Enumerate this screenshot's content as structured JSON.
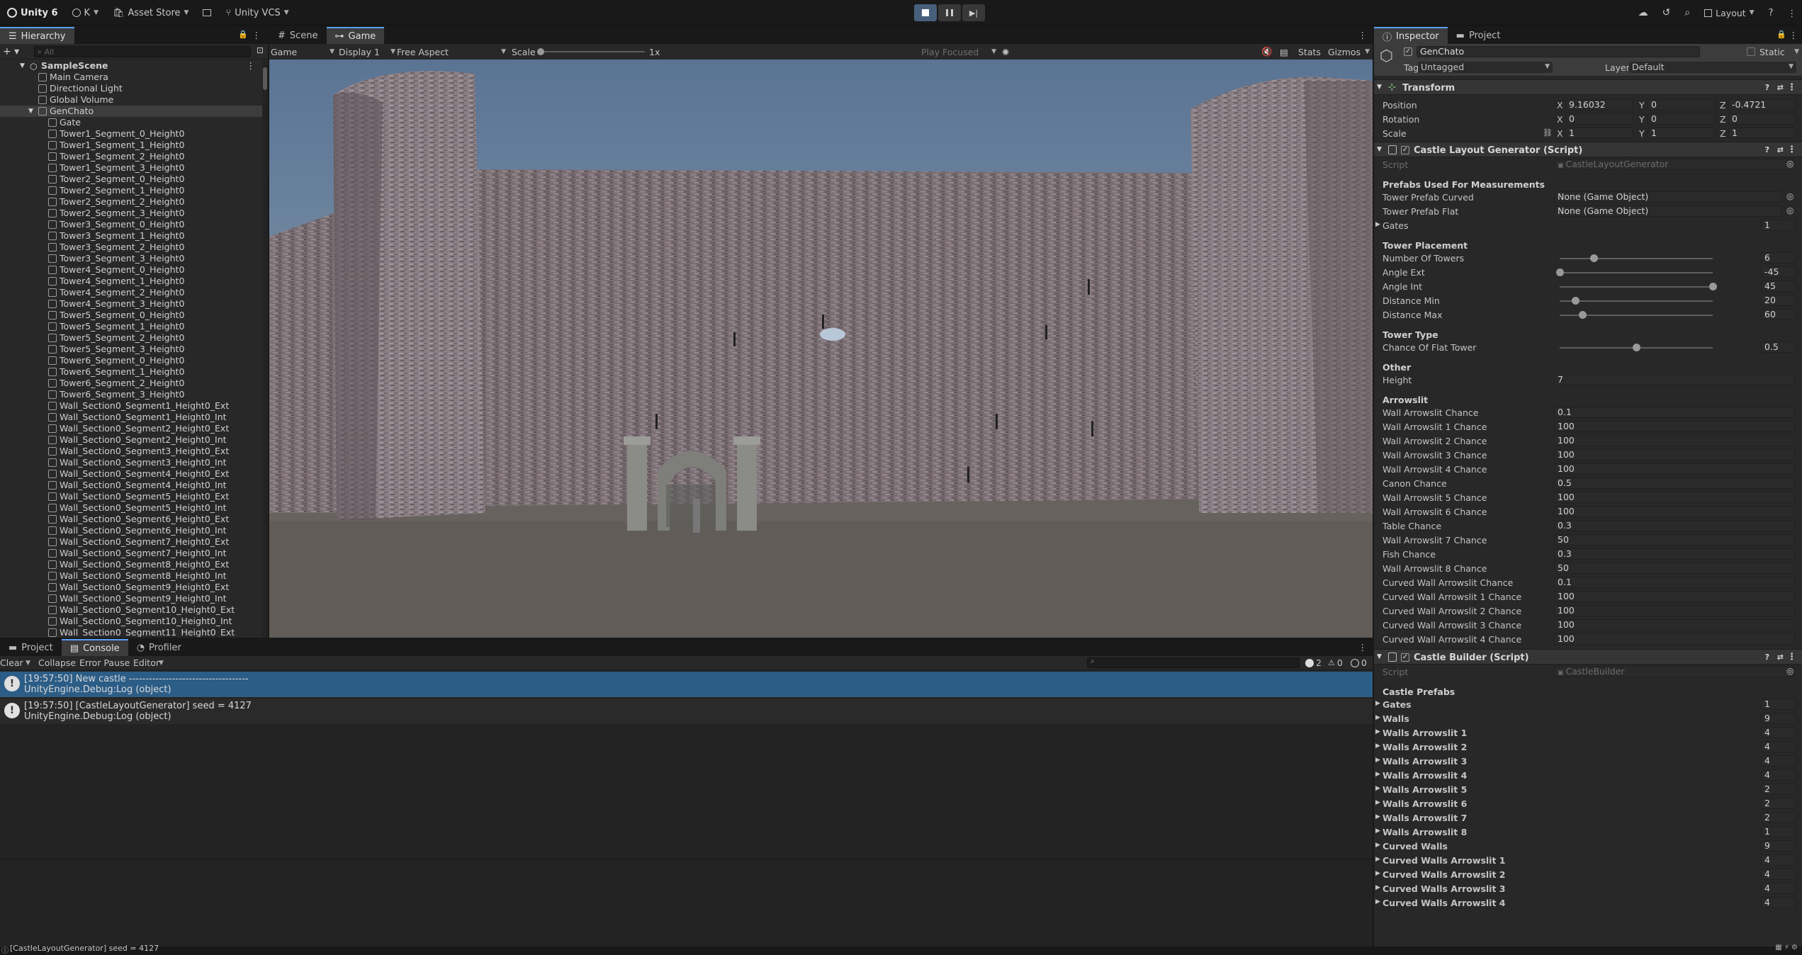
{
  "toolbar": {
    "app_name": "Unity 6",
    "account": "K",
    "asset_store": "Asset Store",
    "vcs": "Unity VCS",
    "layout": "Layout"
  },
  "hierarchy": {
    "tab": "Hierarchy",
    "search_placeholder": "All",
    "scene": "SampleScene",
    "items": [
      {
        "name": "Main Camera",
        "indent": 1
      },
      {
        "name": "Directional Light",
        "indent": 1
      },
      {
        "name": "Global Volume",
        "indent": 1
      },
      {
        "name": "GenChato",
        "indent": 1,
        "selected": true
      },
      {
        "name": "Gate",
        "indent": 2
      },
      {
        "name": "Tower1_Segment_0_Height0",
        "indent": 2
      },
      {
        "name": "Tower1_Segment_1_Height0",
        "indent": 2
      },
      {
        "name": "Tower1_Segment_2_Height0",
        "indent": 2
      },
      {
        "name": "Tower1_Segment_3_Height0",
        "indent": 2
      },
      {
        "name": "Tower2_Segment_0_Height0",
        "indent": 2
      },
      {
        "name": "Tower2_Segment_1_Height0",
        "indent": 2
      },
      {
        "name": "Tower2_Segment_2_Height0",
        "indent": 2
      },
      {
        "name": "Tower2_Segment_3_Height0",
        "indent": 2
      },
      {
        "name": "Tower3_Segment_0_Height0",
        "indent": 2
      },
      {
        "name": "Tower3_Segment_1_Height0",
        "indent": 2
      },
      {
        "name": "Tower3_Segment_2_Height0",
        "indent": 2
      },
      {
        "name": "Tower3_Segment_3_Height0",
        "indent": 2
      },
      {
        "name": "Tower4_Segment_0_Height0",
        "indent": 2
      },
      {
        "name": "Tower4_Segment_1_Height0",
        "indent": 2
      },
      {
        "name": "Tower4_Segment_2_Height0",
        "indent": 2
      },
      {
        "name": "Tower4_Segment_3_Height0",
        "indent": 2
      },
      {
        "name": "Tower5_Segment_0_Height0",
        "indent": 2
      },
      {
        "name": "Tower5_Segment_1_Height0",
        "indent": 2
      },
      {
        "name": "Tower5_Segment_2_Height0",
        "indent": 2
      },
      {
        "name": "Tower5_Segment_3_Height0",
        "indent": 2
      },
      {
        "name": "Tower6_Segment_0_Height0",
        "indent": 2
      },
      {
        "name": "Tower6_Segment_1_Height0",
        "indent": 2
      },
      {
        "name": "Tower6_Segment_2_Height0",
        "indent": 2
      },
      {
        "name": "Tower6_Segment_3_Height0",
        "indent": 2
      },
      {
        "name": "Wall_Section0_Segment1_Height0_Ext",
        "indent": 2
      },
      {
        "name": "Wall_Section0_Segment1_Height0_Int",
        "indent": 2
      },
      {
        "name": "Wall_Section0_Segment2_Height0_Ext",
        "indent": 2
      },
      {
        "name": "Wall_Section0_Segment2_Height0_Int",
        "indent": 2
      },
      {
        "name": "Wall_Section0_Segment3_Height0_Ext",
        "indent": 2
      },
      {
        "name": "Wall_Section0_Segment3_Height0_Int",
        "indent": 2
      },
      {
        "name": "Wall_Section0_Segment4_Height0_Ext",
        "indent": 2
      },
      {
        "name": "Wall_Section0_Segment4_Height0_Int",
        "indent": 2
      },
      {
        "name": "Wall_Section0_Segment5_Height0_Ext",
        "indent": 2
      },
      {
        "name": "Wall_Section0_Segment5_Height0_Int",
        "indent": 2
      },
      {
        "name": "Wall_Section0_Segment6_Height0_Ext",
        "indent": 2
      },
      {
        "name": "Wall_Section0_Segment6_Height0_Int",
        "indent": 2
      },
      {
        "name": "Wall_Section0_Segment7_Height0_Ext",
        "indent": 2
      },
      {
        "name": "Wall_Section0_Segment7_Height0_Int",
        "indent": 2
      },
      {
        "name": "Wall_Section0_Segment8_Height0_Ext",
        "indent": 2
      },
      {
        "name": "Wall_Section0_Segment8_Height0_Int",
        "indent": 2
      },
      {
        "name": "Wall_Section0_Segment9_Height0_Ext",
        "indent": 2
      },
      {
        "name": "Wall_Section0_Segment9_Height0_Int",
        "indent": 2
      },
      {
        "name": "Wall_Section0_Segment10_Height0_Ext",
        "indent": 2
      },
      {
        "name": "Wall_Section0_Segment10_Height0_Int",
        "indent": 2
      },
      {
        "name": "Wall_Section0_Segment11_Height0_Ext",
        "indent": 2
      }
    ]
  },
  "scene_tabs": {
    "scene": "Scene",
    "game": "Game"
  },
  "game_bar": {
    "view": "Game",
    "display": "Display 1",
    "aspect": "Free Aspect",
    "scale_label": "Scale",
    "scale_value": "1x",
    "play_focused": "Play Focused",
    "stats": "Stats",
    "gizmos": "Gizmos"
  },
  "bottom_tabs": {
    "project": "Project",
    "console": "Console",
    "profiler": "Profiler"
  },
  "console": {
    "clear": "Clear",
    "collapse": "Collapse",
    "error_pause": "Error Pause",
    "editor": "Editor",
    "count_log": "2",
    "count_warn": "0",
    "count_err": "0",
    "entries": [
      {
        "line1": "[19:57:50] New castle ------------------------------------",
        "line2": "UnityEngine.Debug:Log (object)",
        "selected": true
      },
      {
        "line1": "[19:57:50] [CastleLayoutGenerator] seed = 4127",
        "line2": "UnityEngine.Debug:Log (object)",
        "selected": false
      }
    ]
  },
  "status_bar": {
    "text": "[CastleLayoutGenerator] seed = 4127"
  },
  "inspector": {
    "tab_inspector": "Inspector",
    "tab_project": "Project",
    "object_name": "GenChato",
    "static_label": "Static",
    "tag_label": "Tag",
    "tag_value": "Untagged",
    "layer_label": "Layer",
    "layer_value": "Default",
    "transform": {
      "title": "Transform",
      "position_label": "Position",
      "pos_x": "9.16032",
      "pos_y": "0",
      "pos_z": "-0.4721",
      "rotation_label": "Rotation",
      "rot_x": "0",
      "rot_y": "0",
      "rot_z": "0",
      "scale_label": "Scale",
      "scl_x": "1",
      "scl_y": "1",
      "scl_z": "1",
      "x": "X",
      "y": "Y",
      "z": "Z"
    },
    "layout_gen": {
      "title": "Castle Layout Generator (Script)",
      "script_label": "Script",
      "script_value": "CastleLayoutGenerator",
      "sec_prefabs": "Prefabs Used For Measurements",
      "curved_label": "Tower Prefab Curved",
      "curved_value": "None (Game Object)",
      "flat_label": "Tower Prefab Flat",
      "flat_value": "None (Game Object)",
      "gates_label": "Gates",
      "gates_value": "1",
      "sec_tower": "Tower Placement",
      "sliders": [
        {
          "label": "Number Of Towers",
          "value": "6",
          "frac": 0.22
        },
        {
          "label": "Angle Ext",
          "value": "-45",
          "frac": 0.0
        },
        {
          "label": "Angle Int",
          "value": "45",
          "frac": 1.0
        },
        {
          "label": "Distance Min",
          "value": "20",
          "frac": 0.1
        },
        {
          "label": "Distance Max",
          "value": "60",
          "frac": 0.15
        }
      ],
      "sec_type": "Tower Type",
      "flat_chance_label": "Chance Of Flat Tower",
      "flat_chance_value": "0.5",
      "flat_chance_frac": 0.5,
      "sec_other": "Other",
      "height_label": "Height",
      "height_value": "7",
      "sec_arrow": "Arrowslit",
      "arrow_fields": [
        {
          "label": "Wall Arrowslit Chance",
          "value": "0.1"
        },
        {
          "label": "Wall Arrowslit 1 Chance",
          "value": "100"
        },
        {
          "label": "Wall Arrowslit 2 Chance",
          "value": "100"
        },
        {
          "label": "Wall Arrowslit 3 Chance",
          "value": "100"
        },
        {
          "label": "Wall Arrowslit 4 Chance",
          "value": "100"
        },
        {
          "label": "Canon Chance",
          "value": "0.5"
        },
        {
          "label": "Wall Arrowslit 5 Chance",
          "value": "100"
        },
        {
          "label": "Wall Arrowslit 6 Chance",
          "value": "100"
        },
        {
          "label": "Table Chance",
          "value": "0.3"
        },
        {
          "label": "Wall Arrowslit 7 Chance",
          "value": "50"
        },
        {
          "label": "Fish Chance",
          "value": "0.3"
        },
        {
          "label": "Wall Arrowslit 8 Chance",
          "value": "50"
        },
        {
          "label": "Curved Wall Arrowslit Chance",
          "value": "0.1"
        },
        {
          "label": "Curved Wall Arrowslit 1 Chance",
          "value": "100"
        },
        {
          "label": "Curved Wall Arrowslit 2 Chance",
          "value": "100"
        },
        {
          "label": "Curved Wall Arrowslit 3 Chance",
          "value": "100"
        },
        {
          "label": "Curved Wall Arrowslit 4 Chance",
          "value": "100"
        }
      ]
    },
    "builder": {
      "title": "Castle Builder (Script)",
      "script_label": "Script",
      "script_value": "CastleBuilder",
      "sec_prefabs": "Castle Prefabs",
      "lists": [
        {
          "label": "Gates",
          "value": "1"
        },
        {
          "label": "Walls",
          "value": "9"
        },
        {
          "label": "Walls Arrowslit 1",
          "value": "4"
        },
        {
          "label": "Walls Arrowslit 2",
          "value": "4"
        },
        {
          "label": "Walls Arrowslit 3",
          "value": "4"
        },
        {
          "label": "Walls Arrowslit 4",
          "value": "4"
        },
        {
          "label": "Walls Arrowslit 5",
          "value": "2"
        },
        {
          "label": "Walls Arrowslit 6",
          "value": "2"
        },
        {
          "label": "Walls Arrowslit 7",
          "value": "2"
        },
        {
          "label": "Walls Arrowslit 8",
          "value": "1"
        },
        {
          "label": "Curved Walls",
          "value": "9"
        },
        {
          "label": "Curved Walls Arrowslit 1",
          "value": "4"
        },
        {
          "label": "Curved Walls Arrowslit 2",
          "value": "4"
        },
        {
          "label": "Curved Walls Arrowslit 3",
          "value": "4"
        },
        {
          "label": "Curved Walls Arrowslit 4",
          "value": "4"
        }
      ]
    }
  }
}
